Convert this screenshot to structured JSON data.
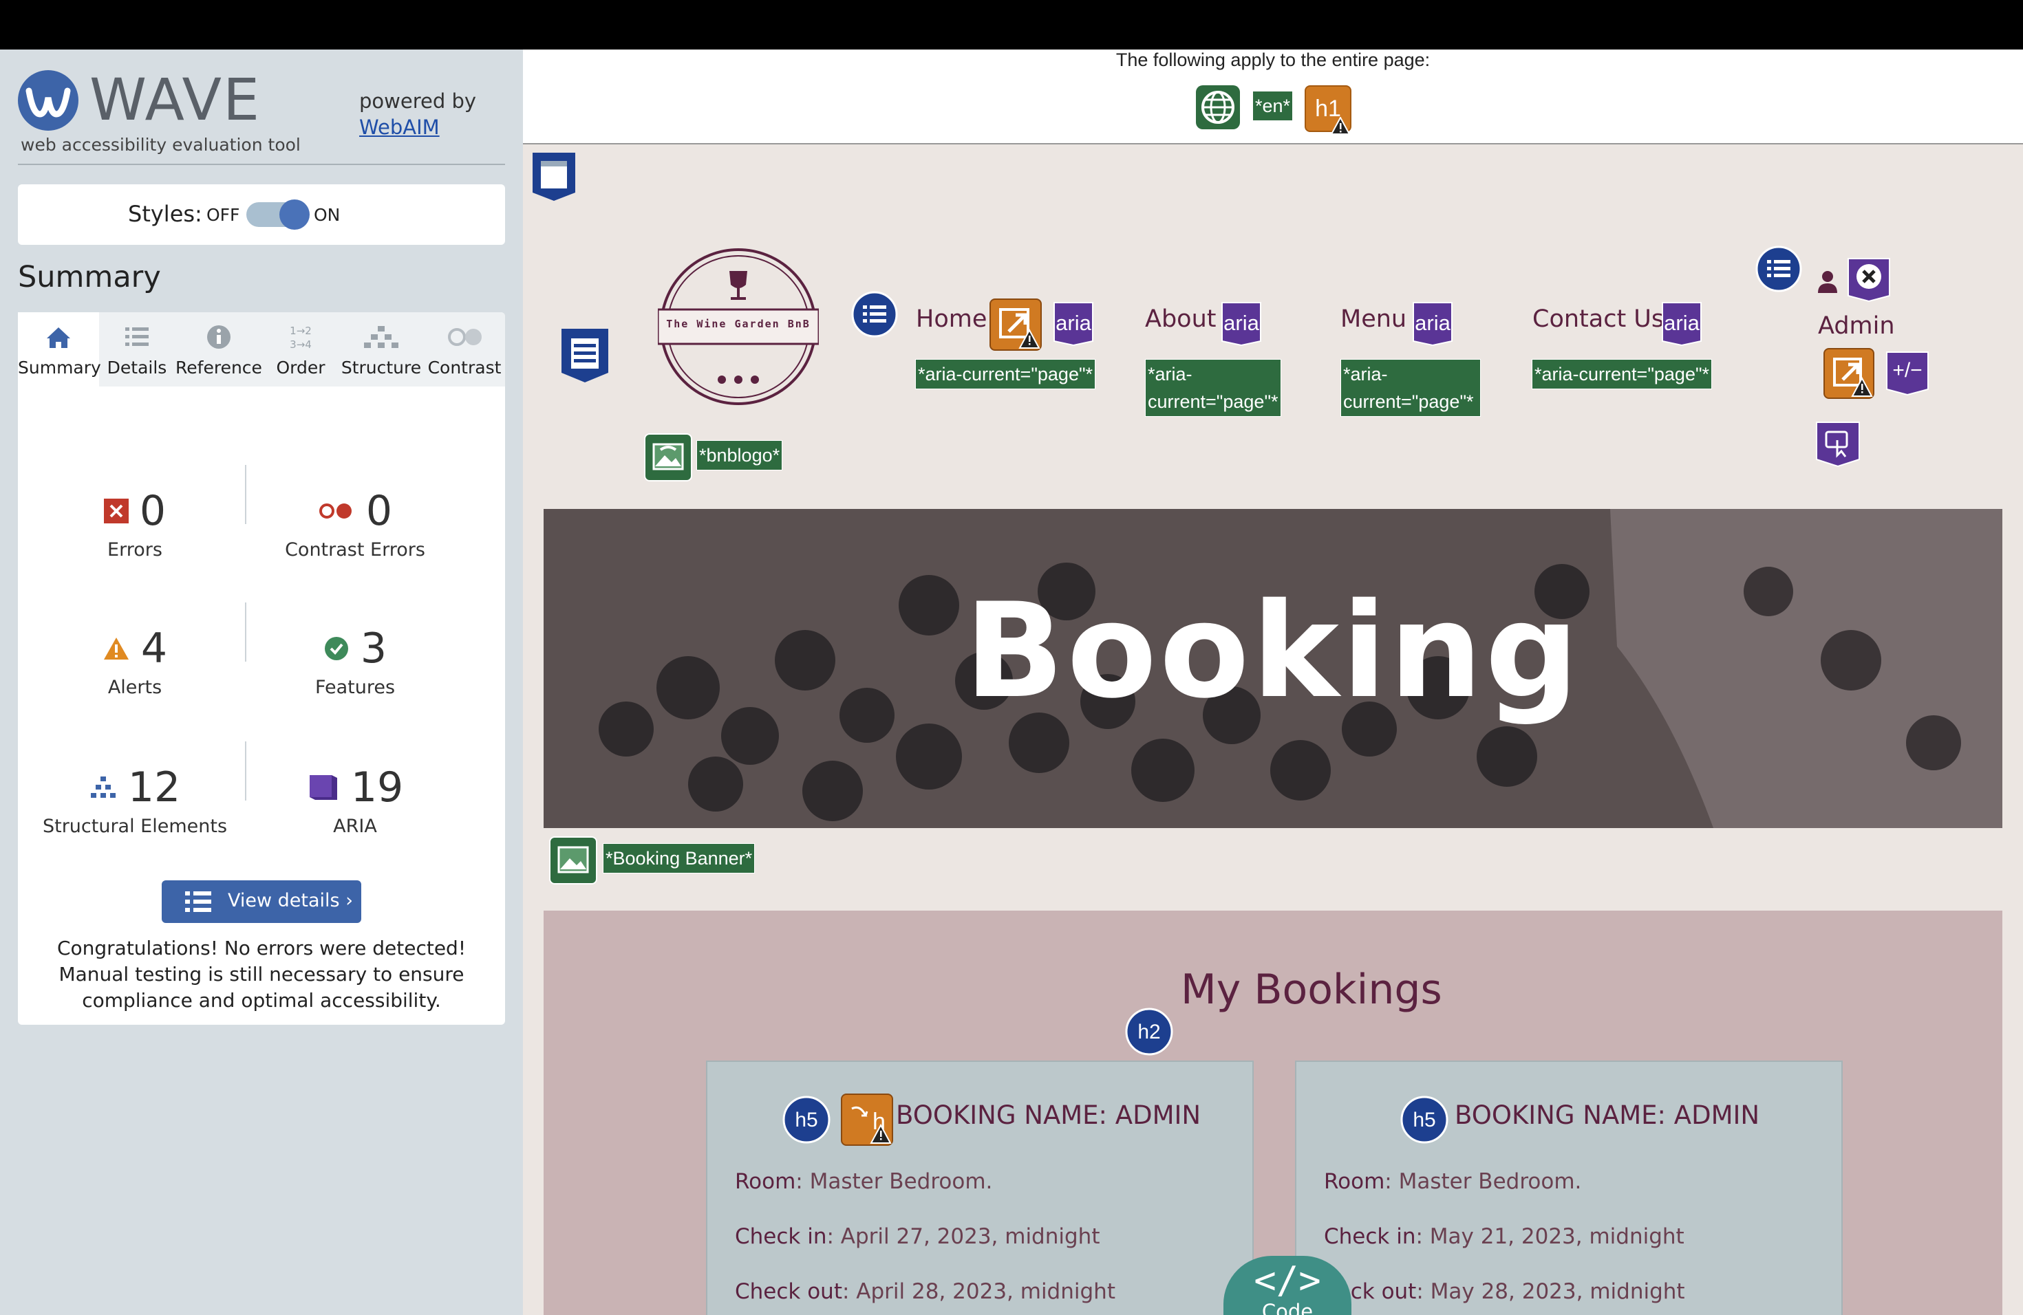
{
  "wave": {
    "logo_text": "WAVE",
    "logo_sub": "web accessibility evaluation tool",
    "powered_by": "powered by",
    "webaim_link": "WebAIM",
    "styles_label": "Styles:",
    "styles_off": "OFF",
    "styles_on": "ON",
    "styles_state": "on",
    "summary_title": "Summary",
    "tabs": [
      {
        "label": "Summary",
        "icon": "home-icon",
        "active": true
      },
      {
        "label": "Details",
        "icon": "list-icon"
      },
      {
        "label": "Reference",
        "icon": "info-icon"
      },
      {
        "label": "Order",
        "icon": "order-icon"
      },
      {
        "label": "Structure",
        "icon": "structure-icon"
      },
      {
        "label": "Contrast",
        "icon": "contrast-icon"
      }
    ],
    "stats": {
      "errors": {
        "value": "0",
        "label": "Errors"
      },
      "contrast_errors": {
        "value": "0",
        "label": "Contrast Errors"
      },
      "alerts": {
        "value": "4",
        "label": "Alerts"
      },
      "features": {
        "value": "3",
        "label": "Features"
      },
      "structural": {
        "value": "12",
        "label": "Structural Elements"
      },
      "aria": {
        "value": "19",
        "label": "ARIA"
      }
    },
    "view_details": "View details ›",
    "congrats": "Congratulations! No errors were detected! Manual testing is still necessary to ensure compliance and optimal accessibility."
  },
  "page": {
    "applies_text": "The following apply to the entire page:",
    "lang_badge": "*en*",
    "h1_badge": "h1",
    "logo_caption": "*bnblogo*",
    "logo_text": "The Wine Garden BnB",
    "nav": [
      {
        "label": "Home",
        "current": "*aria-current=\"page\"*"
      },
      {
        "label": "About",
        "current": "*aria-\ncurrent=\"page\"*"
      },
      {
        "label": "Menu",
        "current": "*aria-\ncurrent=\"page\"*"
      },
      {
        "label": "Contact Us",
        "current": "*aria-current=\"page\"*"
      }
    ],
    "aria_text": "aria",
    "admin_label": "Admin",
    "plusminus": "+/−",
    "banner_title": "Booking",
    "banner_caption": "*Booking Banner*",
    "bookings_title": "My Bookings",
    "h2_badge": "h2",
    "h5_badge": "h5",
    "cards": [
      {
        "title": "BOOKING NAME: ADMIN",
        "room_label": "Room",
        "room": ": Master Bedroom.",
        "checkin_label": "Check in",
        "checkin": ": April 27, 2023, midnight",
        "checkout_label": "Check out",
        "checkout": ": April 28, 2023, midnight"
      },
      {
        "title": "BOOKING NAME: ADMIN",
        "room_label": "Room",
        "room": ": Master Bedroom.",
        "checkin_label": "Check in",
        "checkin": ": May 21, 2023, midnight",
        "checkout_label": "heck out",
        "checkout": ": May 28, 2023, midnight"
      }
    ],
    "code_symbol": "</>",
    "code_label": "Code"
  },
  "colors": {
    "wave_blue": "#3d64a8",
    "brand_maroon": "#5b2240",
    "feature_green": "#2e6b3f",
    "alert_orange": "#d07a22",
    "aria_purple": "#5a3596",
    "structure_navy": "#1d3f8f"
  }
}
